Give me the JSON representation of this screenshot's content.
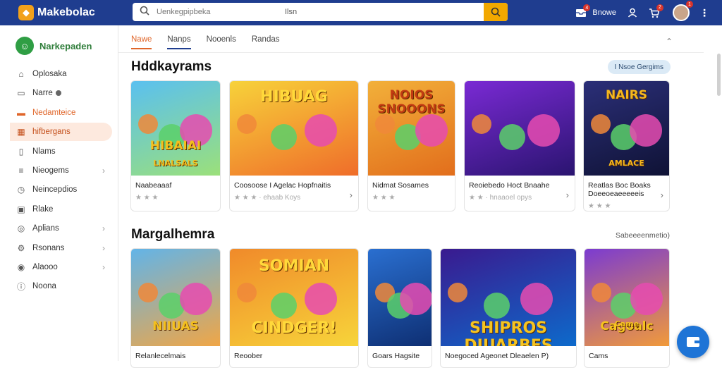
{
  "app": {
    "title": "Makebolac"
  },
  "search": {
    "placeholder": "Uenkegpipbeka",
    "scope": "Ilsn"
  },
  "topbar": {
    "notif_count": "4",
    "user_label": "Bnowe",
    "cart_count": "2",
    "profile_count": "1"
  },
  "sidebar": {
    "brand": "Narkepaden",
    "items": [
      {
        "label": "Oplosaka",
        "icon": "home-icon"
      },
      {
        "label": "Narre",
        "icon": "bag-icon"
      },
      {
        "label": "Nedamteice",
        "icon": "card-icon",
        "style": "orange"
      },
      {
        "label": "hifbergans",
        "icon": "grid-icon",
        "style": "active"
      },
      {
        "label": "Nlams",
        "icon": "doc-icon"
      },
      {
        "label": "Nieogems",
        "icon": "list-icon",
        "chevron": true
      },
      {
        "label": "Neincepdios",
        "icon": "clock-icon"
      },
      {
        "label": "Rlake",
        "icon": "box-icon"
      },
      {
        "label": "Aplians",
        "icon": "settings-icon",
        "chevron": true
      },
      {
        "label": "Rsonans",
        "icon": "gear-icon",
        "chevron": true
      },
      {
        "label": "Alaooo",
        "icon": "compass-icon",
        "chevron": true
      },
      {
        "label": "Noona",
        "icon": "info-icon"
      }
    ]
  },
  "tabs": [
    "Nawe",
    "Nanps",
    "Nooenls",
    "Randas"
  ],
  "section1": {
    "title": "Hddkayrams",
    "pill": "I Nsoe Gergims"
  },
  "section2": {
    "title": "Margalhemra",
    "see_more": "Sabeeeenmetio)"
  },
  "row1": [
    {
      "thumb_title": "HIBAIAI",
      "thumb_sub": "LNALSALS",
      "title": "Naabeaaaf",
      "stars": "★ ★ ★",
      "chevron": false
    },
    {
      "thumb_title": "HIBUAG",
      "thumb_sub": "",
      "title": "Coosoose I Agelac Hopfnaitis",
      "stars": "★ ★ ★ · ehaab Koys",
      "chevron": true
    },
    {
      "thumb_title": "NOIOS SNOOONS",
      "thumb_sub": "",
      "title": "Nidmat Sosames",
      "stars": "★ ★ ★",
      "chevron": false
    },
    {
      "thumb_title": "",
      "thumb_sub": "",
      "title": "Reoiebedo Hoct Bnaahe",
      "stars": "★ ★ · hnaaoel opys",
      "chevron": true
    },
    {
      "thumb_title": "NAIRS",
      "thumb_sub": "AMLACE",
      "title": "Reatlas Boc Boaks Doeeoeaeeeeeis",
      "stars": "★ ★ ★",
      "chevron": true
    }
  ],
  "row2": [
    {
      "thumb_title": "NIIUAS",
      "title": "Relanlecelmais"
    },
    {
      "thumb_title": "SOMIAN",
      "thumb_sub": "CINDGER!",
      "title": "Reoober"
    },
    {
      "thumb_title": "",
      "title": "Goars Hagsite"
    },
    {
      "thumb_title": "SHIPROS DIUARBES",
      "title": "Noegoced Ageonet Dleaelen P)"
    },
    {
      "thumb_title": "Cagoalc",
      "thumb_sub": "Came",
      "title": "Cams"
    }
  ],
  "colors": {
    "header": "#1f3d8f",
    "accent": "#e0662a",
    "search_button": "#f2a800",
    "fab": "#1e74d6"
  }
}
